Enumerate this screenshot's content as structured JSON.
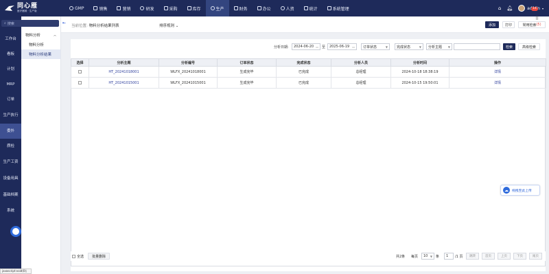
{
  "brand": {
    "name": "同心雁",
    "tagline": "医疗器械 · 生产版"
  },
  "nav": [
    {
      "label": "GMP",
      "icon": "gmp-icon"
    },
    {
      "label": "销售",
      "icon": "sales-icon"
    },
    {
      "label": "营销",
      "icon": "marketing-icon"
    },
    {
      "label": "研发",
      "icon": "rnd-icon"
    },
    {
      "label": "采购",
      "icon": "purchase-icon"
    },
    {
      "label": "库存",
      "icon": "inventory-icon"
    },
    {
      "label": "生产",
      "icon": "production-icon",
      "active": true
    },
    {
      "label": "财务",
      "icon": "finance-icon"
    },
    {
      "label": "办公",
      "icon": "office-icon"
    },
    {
      "label": "人资",
      "icon": "hr-icon"
    },
    {
      "label": "统计",
      "icon": "stats-icon"
    },
    {
      "label": "系统管理",
      "icon": "system-icon"
    }
  ],
  "topright": {
    "badge": "14",
    "user": "admin"
  },
  "sidebar": {
    "search_placeholder": "搜索",
    "items": [
      "工作台",
      "看板",
      "计划",
      "MRP",
      "订单",
      "生产执行",
      "委外",
      "质检",
      "生产工资",
      "设备用具",
      "基础档案",
      "系统"
    ]
  },
  "submenu": {
    "group": "物料分析",
    "items": [
      "物料分析",
      "物料分析结果"
    ]
  },
  "crumb": {
    "prefix": "当前位置:",
    "page": "物料分析结果列表",
    "sort": "排序规则"
  },
  "toolbar": {
    "add": "添加",
    "print": "打印",
    "common_search": "常用检索",
    "common_count": "(5)"
  },
  "filters": {
    "date_label": "分析日期:",
    "date_from": "2024-06-20",
    "to": "至",
    "date_to": "2025-06-19",
    "order_status": "订单状态",
    "complete_status": "完成状态",
    "subject": "分析主题",
    "keyword": "",
    "search": "检索",
    "advanced": "高级检索"
  },
  "table": {
    "columns": [
      "选择",
      "分析主题",
      "分析编号",
      "订单状态",
      "完成状态",
      "分析人员",
      "分析时间",
      "操作"
    ],
    "rows": [
      {
        "subject": "HT_20241018001",
        "code": "WLFX_20241018001",
        "order_status": "生成完毕",
        "complete_status": "已完成",
        "person": "总经理",
        "time": "2024-10-18 18:38:19",
        "action": "详情"
      },
      {
        "subject": "HT_20241015001",
        "code": "WLFX_20241015001",
        "order_status": "生成完毕",
        "complete_status": "已完成",
        "person": "总经理",
        "time": "2024-10-15 19:50:01",
        "action": "详情"
      }
    ]
  },
  "footer": {
    "select_all": "全选",
    "batch_delete": "批量删除",
    "total": "共2条",
    "per_page": "每页",
    "per_page_value": "10",
    "unit": "条",
    "page": "1",
    "page_total": "/1 页",
    "btns": [
      "跳转",
      "首页",
      "上页",
      "下页",
      "尾页"
    ]
  },
  "upload": "拖拽至此上传",
  "status_bar": "javascript:void(0);"
}
